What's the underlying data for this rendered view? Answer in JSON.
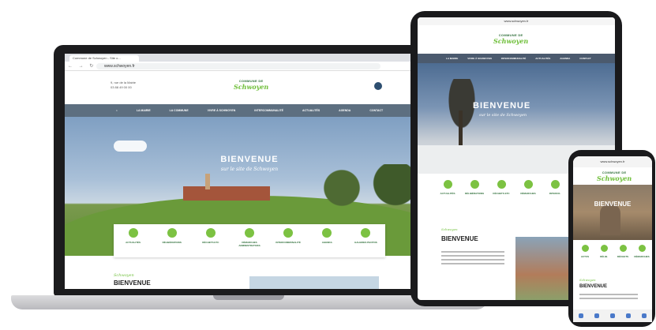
{
  "laptop": {
    "tab_title": "Commune de Schwoyen - Site o...",
    "nav_icons": "← → ↻ ⌂",
    "url": "www.schwoyen.fr",
    "contact": [
      "9, rue de la Mairie",
      "03 88 49 00 00"
    ],
    "logo_top": "COMMUNE DE",
    "logo_main": "Schwoyen",
    "menu": [
      "⌂",
      "LA MAIRIE",
      "LA COMMUNE",
      "VIVRE À SCHWOYEN",
      "INTERCOMMUNALITÉ",
      "ACTUALITÉS",
      "AGENDA",
      "CONTACT"
    ],
    "hero_title": "BIENVENUE",
    "hero_sub": "sur le site de Schwoyen",
    "quick": [
      "ACTUALITÉS",
      "DÉLIBÉRATIONS",
      "DÉCHETS ETC",
      "DÉMARCHES ADMINISTRATIVES",
      "INTERCOMMUNALITÉ",
      "AGENDA",
      "GALERIES PHOTOS"
    ],
    "bottom_tag": "Schwoyen",
    "bottom_title": "BIENVENUE"
  },
  "tablet": {
    "url": "www.schwoyen.fr",
    "logo_top": "COMMUNE DE",
    "logo_main": "Schwoyen",
    "menu": [
      "LA MAIRIE",
      "VIVRE À SCHWOYEN",
      "INTERCOMMUNALITÉ",
      "ACTUALITÉS",
      "AGENDA",
      "CONTACT"
    ],
    "hero_title": "BIENVENUE",
    "hero_sub": "sur le site de Schwoyen",
    "quick": [
      "ACTUALITÉS",
      "DÉLIBÉRATIONS",
      "DÉCHETS ETC",
      "DÉMARCHES",
      "INTERCO.",
      "AGENDA"
    ],
    "bottom_tag": "Schwoyen",
    "bottom_title": "BIENVENUE"
  },
  "phone": {
    "url": "www.schwoyen.fr",
    "logo_top": "COMMUNE DE",
    "logo_main": "Schwoyen",
    "hero_title": "BIENVENUE",
    "quick": [
      "ACTUS",
      "DÉLIB.",
      "DÉCHETS",
      "DÉMARCHES"
    ],
    "bottom_tag": "Schwoyen",
    "bottom_title": "BIENVENUE"
  }
}
